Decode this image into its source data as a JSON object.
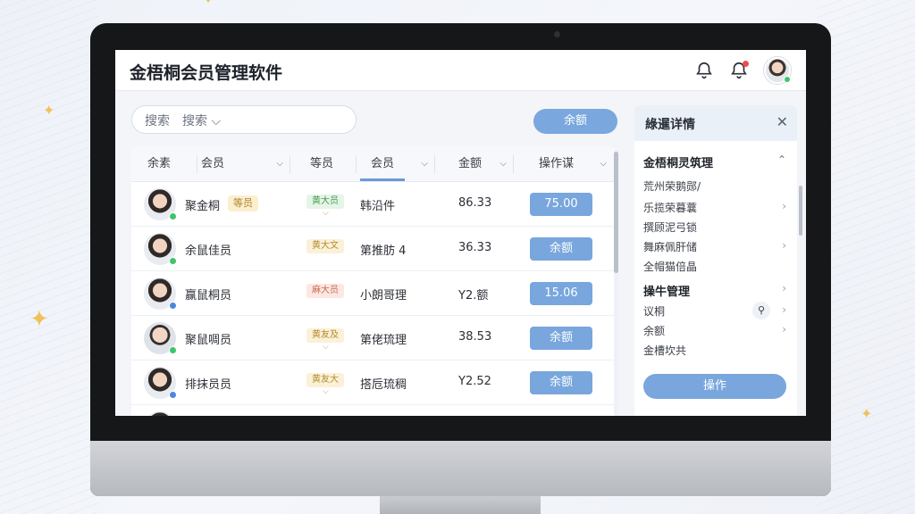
{
  "app": {
    "title": "金梧桐会员管理软件"
  },
  "header": {
    "bell_icon": "bell-icon",
    "notification_icon": "bell-alert-icon",
    "avatar": "user-avatar"
  },
  "search": {
    "label": "搜索",
    "placeholder": "搜索"
  },
  "toolbar": {
    "primary_label": "余额"
  },
  "table": {
    "columns": [
      {
        "label": "余素"
      },
      {
        "label": "会员"
      },
      {
        "label": "等员"
      },
      {
        "label": "会员"
      },
      {
        "label": "金额"
      },
      {
        "label": "操作谋"
      }
    ],
    "rows": [
      {
        "name": "聚金桐",
        "tag": "等员",
        "level": "黄大员",
        "desc": "韩沿件",
        "amount": "86.33",
        "action": "75.00",
        "status": "green"
      },
      {
        "name": "余鼠佳员",
        "level": "黄大文",
        "desc": "第推肪 4",
        "amount": "36.33",
        "action": "余额",
        "status": "green"
      },
      {
        "name": "赢鼠桐员",
        "level": "麻大员",
        "desc": "小朗哥理",
        "amount": "Y2.额",
        "action": "15.06",
        "status": "blue"
      },
      {
        "name": "聚鼠啁员",
        "level": "黄友及",
        "desc": "第佬琉理",
        "amount": "38.53",
        "action": "余额",
        "status": "green"
      },
      {
        "name": "排抹员员",
        "level": "黄友大",
        "desc": "搭卮琉稠",
        "amount": "Y2.52",
        "action": "余额",
        "status": "blue"
      }
    ]
  },
  "panel": {
    "title": "綠暹详情",
    "section1_title": "金梧桐灵筑理",
    "lines": [
      "荒州荣鹅郧/",
      "乐揽荣暮蘘",
      "撰顾泥弓锁",
      "舞麻佩肝储",
      "全帽猫倍晶"
    ],
    "section2_title": "操牛管理",
    "items": [
      "议桐",
      "余额",
      "金槽坎共"
    ],
    "button_label": "操作"
  },
  "colors": {
    "accent": "#78a6dd",
    "online": "#3ec46d",
    "alert": "#ef4b4b"
  }
}
